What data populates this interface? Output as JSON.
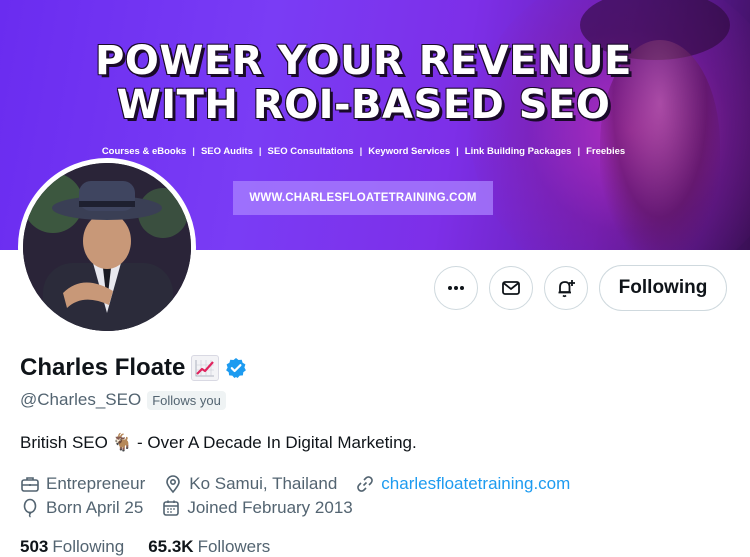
{
  "banner": {
    "headline_line1": "POWER YOUR REVENUE",
    "headline_line2": "WITH ROI-BASED SEO",
    "services": [
      "Courses & eBooks",
      "SEO Audits",
      "SEO Consultations",
      "Keyword Services",
      "Link Building Packages",
      "Freebies"
    ],
    "separator": "|",
    "cta_url": "WWW.CHARLESFLOATETRAINING.COM"
  },
  "actions": {
    "more_icon": "more-icon",
    "message_icon": "envelope-icon",
    "notify_icon": "bell-plus-icon",
    "following_label": "Following"
  },
  "profile": {
    "name": "Charles Floate",
    "name_emoji": "chart-increasing-icon",
    "verified_icon": "verified-badge-icon",
    "handle": "@Charles_SEO",
    "follows_you": "Follows you",
    "bio_prefix": "British SEO",
    "bio_emoji": "🐐",
    "bio_suffix": "- Over A Decade In Digital Marketing.",
    "profession": "Entrepreneur",
    "location": "Ko Samui, Thailand",
    "website": "charlesfloatetraining.com",
    "birthday": "Born April 25",
    "joined": "Joined February 2013"
  },
  "stats": {
    "following_count": "503",
    "following_label": "Following",
    "followers_count": "65.3K",
    "followers_label": "Followers"
  },
  "colors": {
    "accent": "#1d9bf0",
    "banner_purple": "#7a3cf5",
    "text_primary": "#0f1419",
    "text_secondary": "#536471",
    "border": "#cfd9de"
  }
}
